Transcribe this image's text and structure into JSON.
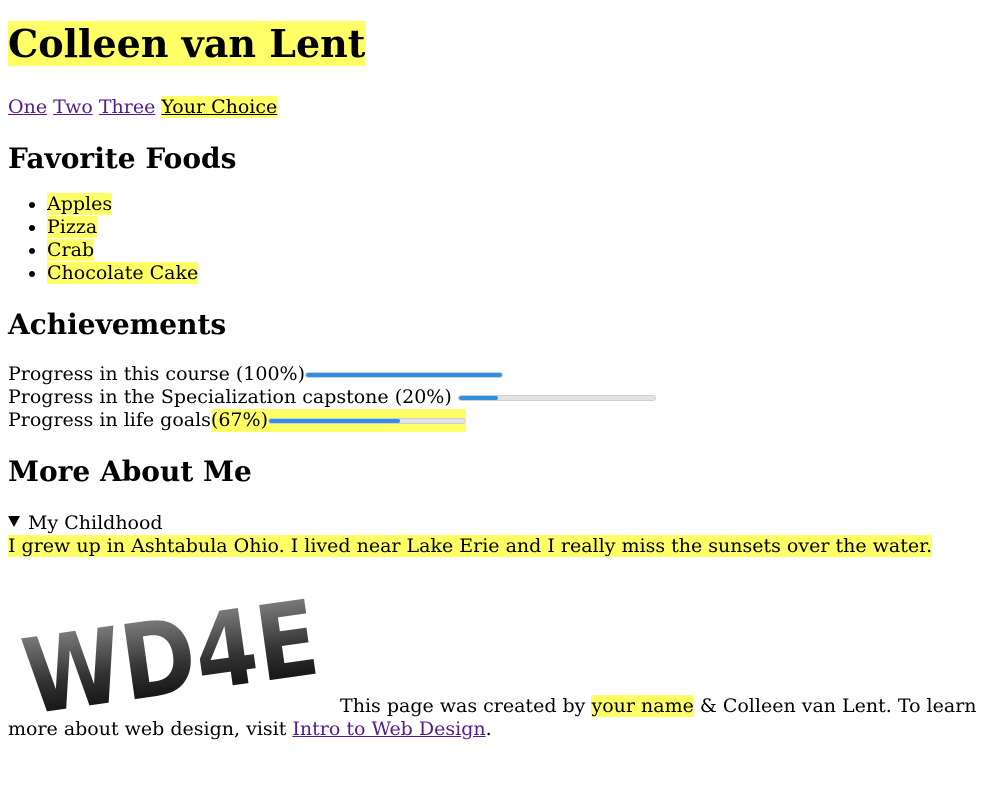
{
  "title": "Colleen van Lent",
  "nav": {
    "one": "One",
    "two": "Two",
    "three": "Three",
    "choice": "Your Choice"
  },
  "foods": {
    "heading": "Favorite Foods",
    "items": [
      "Apples",
      "Pizza",
      "Crab",
      "Chocolate Cake"
    ]
  },
  "achievements": {
    "heading": "Achievements",
    "course": {
      "label": "Progress in this course (100%)",
      "value": 1.0
    },
    "capstone": {
      "label": "Progress in the Specialization capstone (20%)",
      "value": 0.2
    },
    "life": {
      "label": "Progress in life goals ",
      "pct": "(67%)",
      "value": 0.67
    }
  },
  "more": {
    "heading": "More About Me",
    "summary": "My Childhood",
    "text": "I grew up in Ashtabula Ohio. I lived near Lake Erie and I really miss the sunsets over the water."
  },
  "footer": {
    "logo_text": "WD4E",
    "pre": "This page was created by ",
    "name": "your name",
    "mid": " & Colleen van Lent. To learn more about web design, visit ",
    "link": "Intro to Web Design",
    "post": "."
  },
  "colors": {
    "highlight": "#ffff66",
    "progress": "#2f8fe4",
    "visited_link": "#551a8b"
  }
}
